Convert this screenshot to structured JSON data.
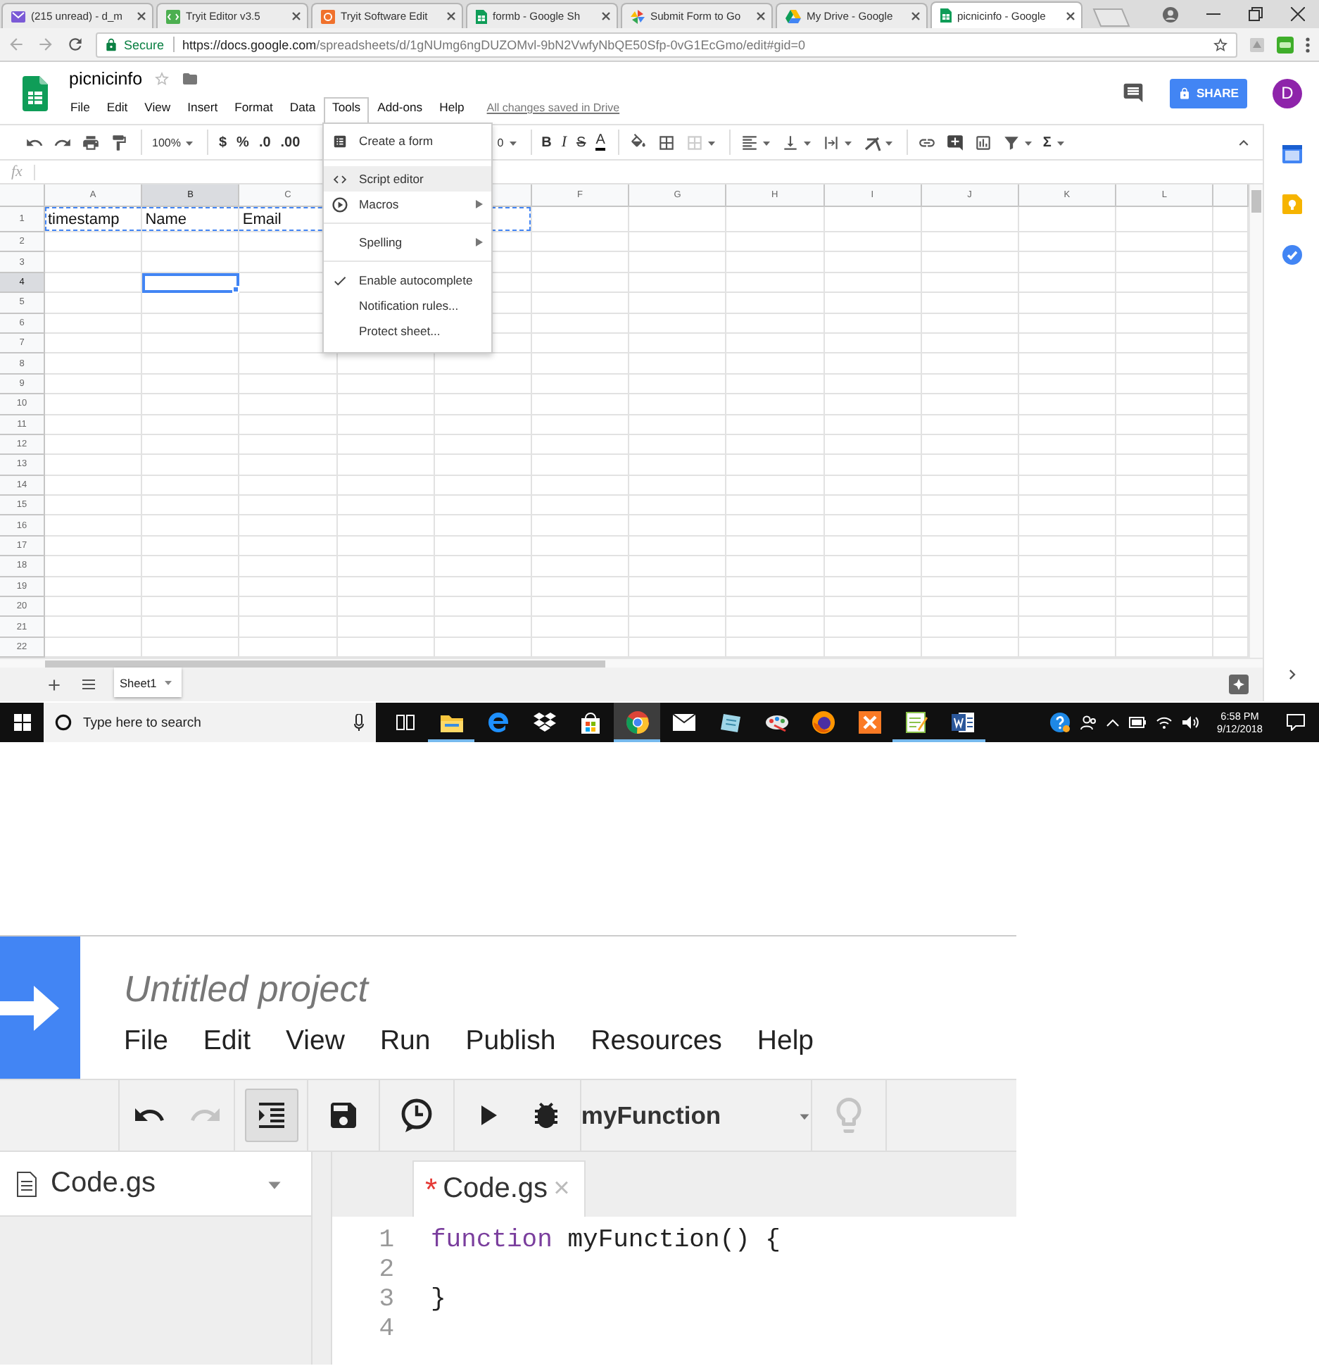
{
  "browser": {
    "tabs": [
      {
        "kind": "mail",
        "title": "(215 unread) - d_m",
        "selected": false
      },
      {
        "kind": "editor",
        "title": "Tryit Editor v3.5",
        "selected": false
      },
      {
        "kind": "software",
        "title": "Tryit Software Edit",
        "selected": false
      },
      {
        "kind": "sheets",
        "title": "formb - Google Sh",
        "selected": false
      },
      {
        "kind": "form",
        "title": "Submit Form to Go",
        "selected": false
      },
      {
        "kind": "drive",
        "title": "My Drive - Google",
        "selected": false
      },
      {
        "kind": "sheets",
        "title": "picnicinfo - Google",
        "selected": true
      }
    ],
    "address": {
      "secure_label": "Secure",
      "url_host": "https://docs.google.com",
      "url_path": "/spreadsheets/d/1gNUmg6ngDUZOMvl-9bN2VwfyNbQE50Sfp-0vG1EcGmo/edit#gid=0"
    }
  },
  "sheets": {
    "title": "picnicinfo",
    "menu": [
      {
        "label": "File",
        "selected": false
      },
      {
        "label": "Edit",
        "selected": false
      },
      {
        "label": "View",
        "selected": false
      },
      {
        "label": "Insert",
        "selected": false
      },
      {
        "label": "Format",
        "selected": false
      },
      {
        "label": "Data",
        "selected": false
      },
      {
        "label": "Tools",
        "selected": true
      },
      {
        "label": "Add-ons",
        "selected": false
      },
      {
        "label": "Help",
        "selected": false
      }
    ],
    "save_status": "All changes saved in Drive",
    "share_label": "SHARE",
    "avatar_initial": "D",
    "toolbar": {
      "zoom": "100%",
      "currency": "$",
      "percent": "%",
      "decimal_less": ".0",
      "decimal_more": ".00",
      "font_size": "0",
      "format": [
        {
          "kind": "bold",
          "label": "B"
        },
        {
          "kind": "italic",
          "label": "I"
        },
        {
          "kind": "strike",
          "label": "S"
        },
        {
          "kind": "color",
          "label": "A"
        }
      ],
      "functions": "Σ"
    },
    "formula_label": "fx",
    "columns": [
      {
        "label": "A",
        "selected": false,
        "copied": true
      },
      {
        "label": "B",
        "selected": true,
        "copied": true
      },
      {
        "label": "C",
        "selected": false,
        "copied": true
      },
      {},
      {
        "copied": true
      },
      {
        "label": "F",
        "selected": false,
        "copied": false
      },
      {
        "label": "G",
        "selected": false,
        "copied": false
      },
      {
        "label": "H",
        "selected": false,
        "copied": false
      },
      {
        "label": "I",
        "selected": false,
        "copied": false
      },
      {
        "label": "J",
        "selected": false,
        "copied": false
      },
      {
        "label": "K",
        "selected": false,
        "copied": false
      },
      {
        "label": "L",
        "selected": false,
        "copied": false
      }
    ],
    "rows": [
      {
        "label": "1",
        "selected": false,
        "copied": true,
        "cells": [
          "timestamp",
          "Name",
          "Email"
        ]
      },
      {
        "label": "2",
        "selected": false,
        "copied": false
      },
      {
        "label": "3",
        "selected": false,
        "copied": false
      },
      {
        "label": "4",
        "selected": true,
        "copied": false
      },
      {
        "label": "5",
        "selected": false,
        "copied": false
      },
      {
        "label": "6",
        "selected": false,
        "copied": false
      },
      {
        "label": "7",
        "selected": false,
        "copied": false
      },
      {
        "label": "8",
        "selected": false,
        "copied": false
      },
      {
        "label": "9",
        "selected": false,
        "copied": false
      },
      {
        "label": "10",
        "selected": false,
        "copied": false
      },
      {
        "label": "11",
        "selected": false,
        "copied": false
      },
      {
        "label": "12",
        "selected": false,
        "copied": false
      },
      {
        "label": "13",
        "selected": false,
        "copied": false
      },
      {
        "label": "14",
        "selected": false,
        "copied": false
      },
      {
        "label": "15",
        "selected": false,
        "copied": false
      },
      {
        "label": "16",
        "selected": false,
        "copied": false
      },
      {
        "label": "17",
        "selected": false,
        "copied": false
      },
      {
        "label": "18",
        "selected": false,
        "copied": false
      },
      {
        "label": "19",
        "selected": false,
        "copied": false
      },
      {
        "label": "20",
        "selected": false,
        "copied": false
      },
      {
        "label": "21",
        "selected": false,
        "copied": false
      },
      {
        "label": "22",
        "selected": false,
        "copied": false
      }
    ],
    "tools_menu": [
      {
        "kind": "form",
        "label": "Create a form",
        "highlighted": false
      },
      {
        "kind": "divider"
      },
      {
        "kind": "script",
        "label": "Script editor",
        "highlighted": true
      },
      {
        "kind": "macros",
        "label": "Macros",
        "highlighted": false
      },
      {
        "kind": "divider"
      },
      {
        "kind": "spelling",
        "label": "Spelling",
        "highlighted": false
      },
      {
        "kind": "divider"
      },
      {
        "kind": "toggle",
        "label": "Enable autocomplete",
        "checked": true,
        "highlighted": false
      },
      {
        "kind": "action",
        "label": "Notification rules...",
        "highlighted": false
      },
      {
        "kind": "action",
        "label": "Protect sheet...",
        "highlighted": false
      }
    ],
    "sheet_tabs": [
      {
        "label": "Sheet1",
        "selected": true
      }
    ]
  },
  "taskbar": {
    "search_placeholder": "Type here to search",
    "apps": [
      {
        "kind": "task-view",
        "selected": false,
        "running": false
      },
      {
        "kind": "explorer",
        "selected": false,
        "running": true
      },
      {
        "kind": "edge",
        "selected": false,
        "running": false
      },
      {
        "kind": "dropbox",
        "selected": false,
        "running": false
      },
      {
        "kind": "store",
        "selected": false,
        "running": false
      },
      {
        "kind": "chrome",
        "selected": true,
        "running": true
      },
      {
        "kind": "mail",
        "selected": false,
        "running": false
      },
      {
        "kind": "notes",
        "selected": false,
        "running": false
      },
      {
        "kind": "paint",
        "selected": false,
        "running": false
      },
      {
        "kind": "firefox",
        "selected": false,
        "running": false
      },
      {
        "kind": "xampp",
        "selected": false,
        "running": false
      },
      {
        "kind": "notepad",
        "selected": false,
        "running": true
      },
      {
        "kind": "word",
        "selected": false,
        "running": true
      }
    ],
    "time": "6:58 PM",
    "date": "9/12/2018"
  },
  "script_editor": {
    "title": "Untitled project",
    "menu": [
      "File",
      "Edit",
      "View",
      "Run",
      "Publish",
      "Resources",
      "Help"
    ],
    "toolbar": [
      {
        "buttons": [
          {
            "kind": "undo",
            "disabled": false,
            "pressed": false
          },
          {
            "kind": "redo",
            "disabled": true,
            "pressed": false
          }
        ]
      },
      {
        "buttons": [
          {
            "kind": "indent",
            "disabled": false,
            "pressed": true
          }
        ]
      },
      {
        "buttons": [
          {
            "kind": "save",
            "disabled": false,
            "pressed": false
          }
        ]
      },
      {
        "buttons": [
          {
            "kind": "triggers",
            "disabled": false,
            "pressed": false
          }
        ]
      },
      {
        "buttons": [
          {
            "kind": "run",
            "disabled": false,
            "pressed": false
          },
          {
            "kind": "debug",
            "disabled": false,
            "pressed": false
          }
        ]
      },
      {
        "buttons": [
          {
            "kind": "function-select",
            "label": "myFunction",
            "disabled": false,
            "pressed": false
          }
        ]
      },
      {
        "buttons": [
          {
            "kind": "hint",
            "disabled": true,
            "pressed": false
          }
        ]
      }
    ],
    "files": [
      {
        "name": "Code.gs"
      }
    ],
    "tabs": [
      {
        "label": "Code.gs",
        "unsaved_mark": "*",
        "close_mark": "×",
        "selected": true
      }
    ],
    "code": [
      {
        "number": "1",
        "tokens": [
          {
            "kind": "keyword",
            "text": "function"
          },
          {
            "kind": "plain",
            "text": " myFunction() {"
          }
        ]
      },
      {
        "number": "2"
      },
      {
        "number": "3",
        "tokens": [
          {
            "kind": "plain",
            "text": "}"
          }
        ]
      },
      {
        "number": "4"
      }
    ]
  }
}
